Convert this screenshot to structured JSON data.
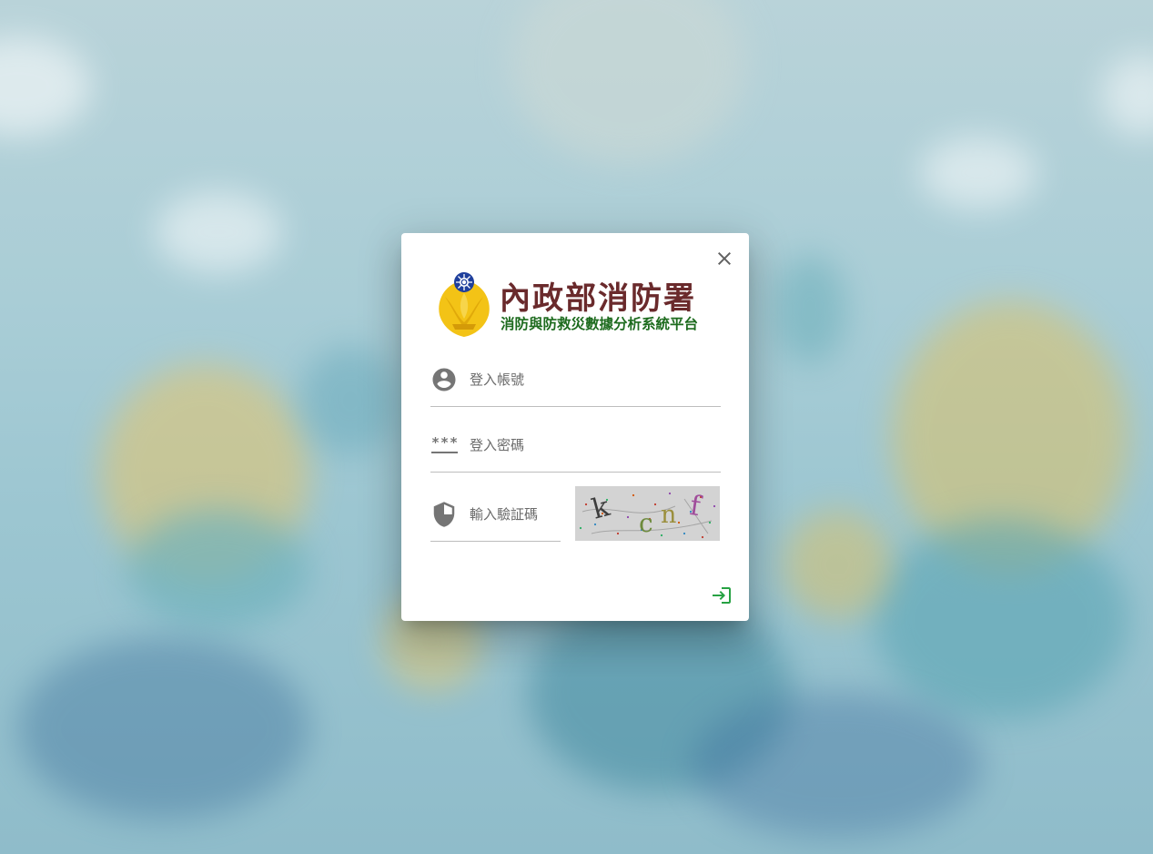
{
  "logo": {
    "title": "內政部消防署",
    "subtitle": "消防與防救災數據分析系統平台"
  },
  "form": {
    "account_placeholder": "登入帳號",
    "password_placeholder": "登入密碼",
    "captcha_placeholder": "輸入驗証碼",
    "password_icon_text": "***"
  },
  "captcha": {
    "characters": [
      "k",
      "c",
      "n",
      "f"
    ]
  },
  "icons": {
    "close": "close-icon",
    "account": "account-circle-icon",
    "password": "password-icon",
    "captcha": "shield-icon",
    "login": "login-icon"
  },
  "colors": {
    "accent": "#27a243",
    "logo_title": "#6a2a2c",
    "logo_subtitle": "#1d6b1e"
  }
}
